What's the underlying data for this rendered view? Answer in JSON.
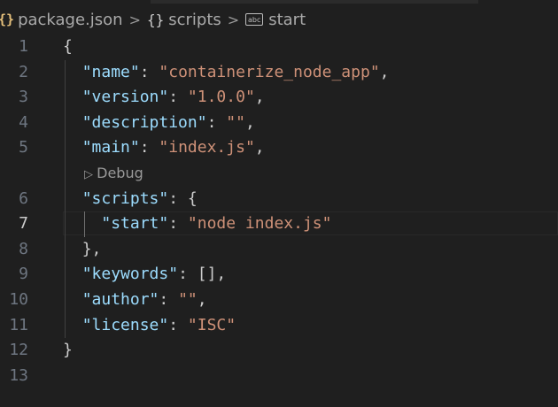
{
  "breadcrumb": {
    "file_icon": "{}",
    "file": "package.json",
    "separator": ">",
    "segment_icon": "{}",
    "segment": "scripts",
    "leaf_icon": "abc",
    "leaf": "start"
  },
  "codelens": {
    "label": "Debug",
    "icon": "play-icon"
  },
  "lines": [
    {
      "n": "1",
      "parts": [
        [
          "p",
          "{"
        ]
      ]
    },
    {
      "n": "2",
      "parts": [
        [
          "k",
          "\"name\""
        ],
        [
          "p",
          ": "
        ],
        [
          "s",
          "\"containerize_node_app\""
        ],
        [
          "p",
          ","
        ]
      ]
    },
    {
      "n": "3",
      "parts": [
        [
          "k",
          "\"version\""
        ],
        [
          "p",
          ": "
        ],
        [
          "s",
          "\"1.0.0\""
        ],
        [
          "p",
          ","
        ]
      ]
    },
    {
      "n": "4",
      "parts": [
        [
          "k",
          "\"description\""
        ],
        [
          "p",
          ": "
        ],
        [
          "s",
          "\"\""
        ],
        [
          "p",
          ","
        ]
      ]
    },
    {
      "n": "5",
      "parts": [
        [
          "k",
          "\"main\""
        ],
        [
          "p",
          ": "
        ],
        [
          "s",
          "\"index.js\""
        ],
        [
          "p",
          ","
        ]
      ]
    },
    {
      "n": "6",
      "parts": [
        [
          "k",
          "\"scripts\""
        ],
        [
          "p",
          ": {"
        ]
      ]
    },
    {
      "n": "7",
      "parts": [
        [
          "k",
          "\"start\""
        ],
        [
          "p",
          ": "
        ],
        [
          "s",
          "\"node index.js\""
        ]
      ]
    },
    {
      "n": "8",
      "parts": [
        [
          "p",
          "},"
        ]
      ]
    },
    {
      "n": "9",
      "parts": [
        [
          "k",
          "\"keywords\""
        ],
        [
          "p",
          ": [],"
        ]
      ]
    },
    {
      "n": "10",
      "parts": [
        [
          "k",
          "\"author\""
        ],
        [
          "p",
          ": "
        ],
        [
          "s",
          "\"\""
        ],
        [
          "p",
          ","
        ]
      ]
    },
    {
      "n": "11",
      "parts": [
        [
          "k",
          "\"license\""
        ],
        [
          "p",
          ": "
        ],
        [
          "s",
          "\"ISC\""
        ]
      ]
    },
    {
      "n": "12",
      "parts": [
        [
          "p",
          "}"
        ]
      ]
    },
    {
      "n": "13",
      "parts": []
    }
  ],
  "current_line": "7",
  "colors": {
    "background": "#1f1f1f",
    "property_key": "#9cdcfe",
    "string_value": "#ce9178",
    "punctuation": "#cccccc",
    "line_number": "#6e7681",
    "breadcrumb_file_icon": "#e5c07b"
  }
}
